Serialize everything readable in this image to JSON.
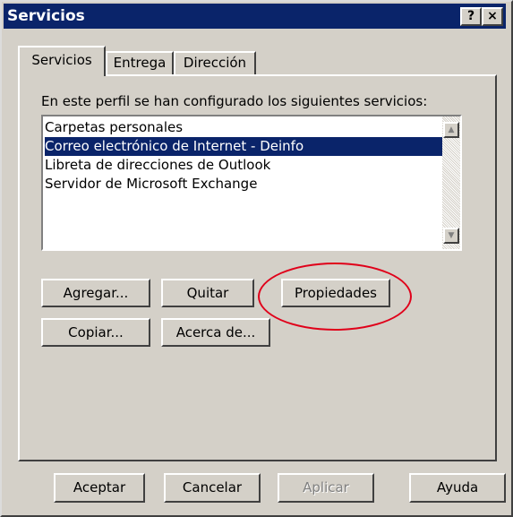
{
  "window": {
    "title": "Servicios",
    "help_button": "?",
    "close_button": "×"
  },
  "tabs": [
    "Servicios",
    "Entrega",
    "Dirección"
  ],
  "panel": {
    "list_label": "En este perfil se han configurado los siguientes servicios:",
    "services": [
      "Carpetas personales",
      "Correo electrónico de Internet - Deinfo",
      "Libreta de direcciones de Outlook",
      "Servidor de Microsoft Exchange"
    ],
    "selected_index": 1,
    "buttons": {
      "add": "Agregar...",
      "remove": "Quitar",
      "properties": "Propiedades",
      "copy": "Copiar...",
      "about": "Acerca de..."
    }
  },
  "footer": {
    "ok": "Aceptar",
    "cancel": "Cancelar",
    "apply": "Aplicar",
    "help": "Ayuda"
  },
  "colors": {
    "title_bar": "#0a246a",
    "dialog_face": "#d4d0c8",
    "highlight_ellipse": "#e0001a"
  }
}
